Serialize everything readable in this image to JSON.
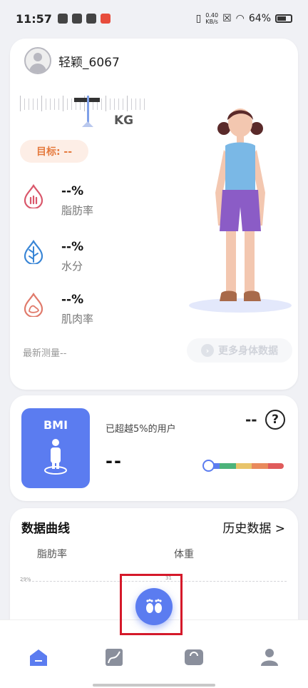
{
  "status_bar": {
    "time": "11:57",
    "net_speed_value": "0.40",
    "net_speed_unit": "KB/s",
    "battery": "64%"
  },
  "profile": {
    "username": "轻颖_6067"
  },
  "weight": {
    "unit": "KG",
    "target_label": "目标: --"
  },
  "metrics": [
    {
      "value": "--%",
      "label": "脂肪率",
      "icon": "fat-drop-icon",
      "color": "#d9576b"
    },
    {
      "value": "--%",
      "label": "水分",
      "icon": "water-leaf-icon",
      "color": "#3a86d6"
    },
    {
      "value": "--%",
      "label": "肌肉率",
      "icon": "muscle-drop-icon",
      "color": "#e07a6b"
    }
  ],
  "latest_measure": "最新测量--",
  "more_data_button": "更多身体数据",
  "bmi": {
    "title": "BMI",
    "exceeded_text": "已超越5%的用户",
    "value": "--",
    "status": "--",
    "help": "?",
    "scale_colors": [
      "#5b7cf0",
      "#4cb37a",
      "#e8c46a",
      "#e98a5c",
      "#e05b5b"
    ]
  },
  "chart_section": {
    "title": "数据曲线",
    "history_link": "历史数据 >",
    "tabs": [
      "脂肪率",
      "体重"
    ],
    "y_label": "29%",
    "x_tick": "31"
  },
  "nav": [
    "home-icon",
    "trend-chart-icon",
    "scale-icon",
    "profile-icon"
  ],
  "accent_color": "#5b7cf0"
}
